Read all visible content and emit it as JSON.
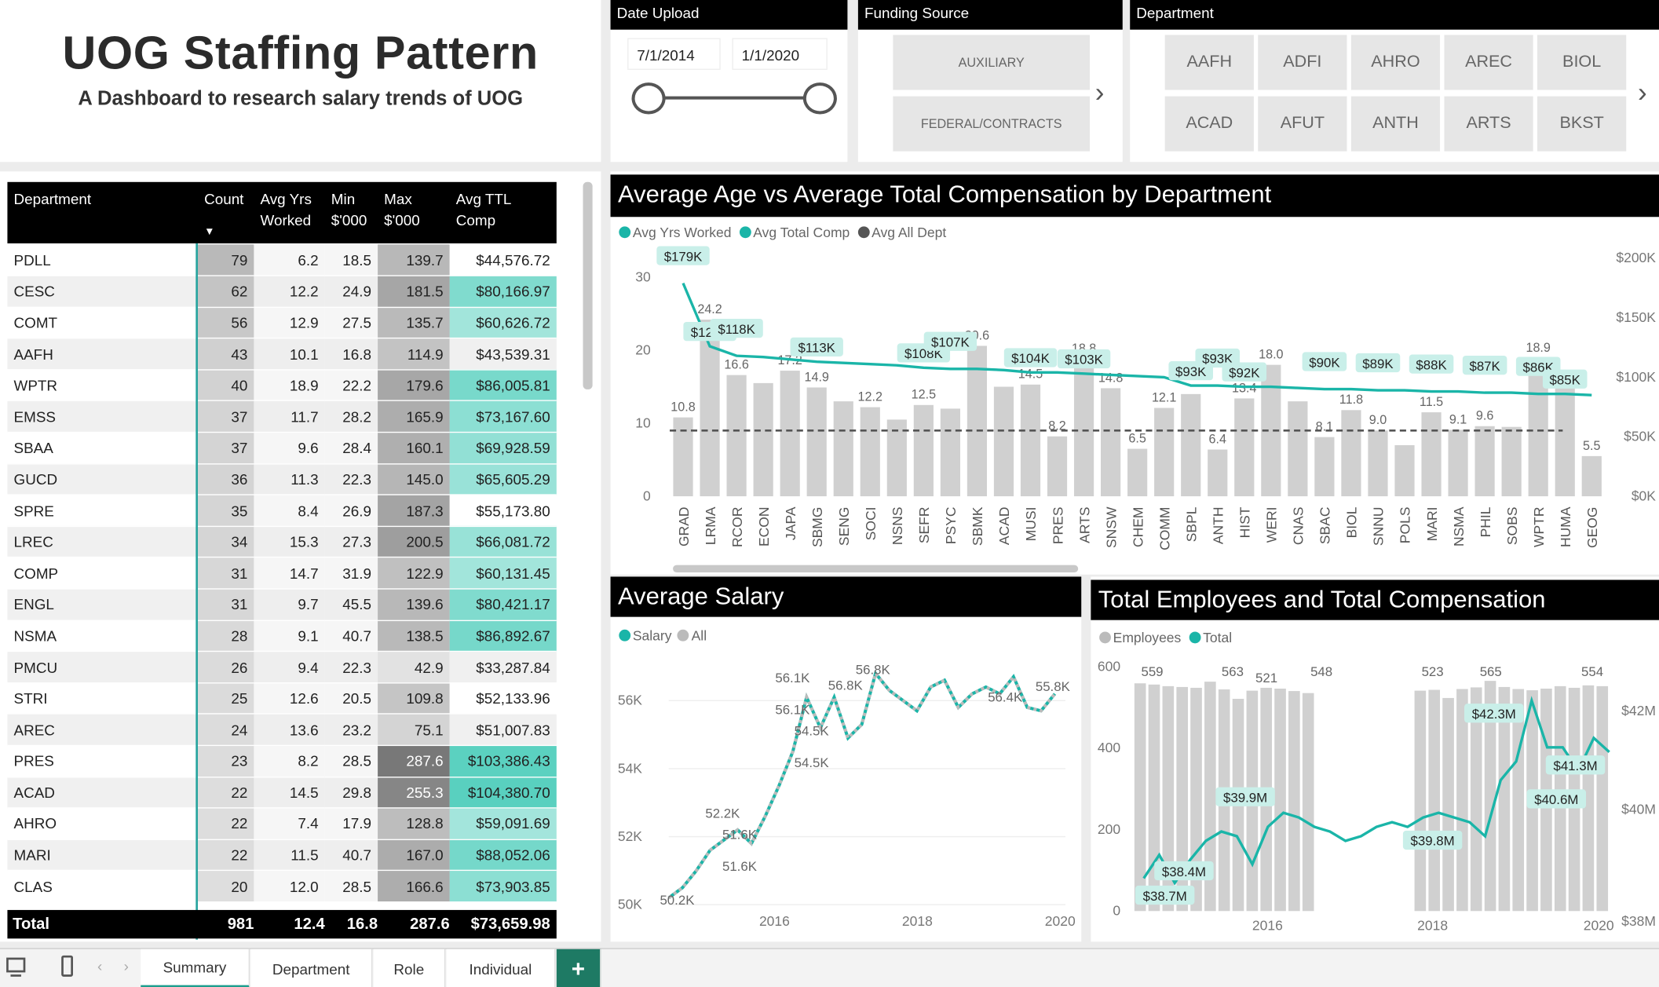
{
  "title": "UOG Staffing Pattern",
  "subtitle": "A Dashboard to research salary trends of UOG",
  "date_slicer": {
    "header": "Date Upload",
    "start": "7/1/2014",
    "end": "1/1/2020"
  },
  "funding_slicer": {
    "header": "Funding Source",
    "items": [
      "AUXILIARY",
      "FEDERAL/CONTRACTS"
    ]
  },
  "dept_slicer": {
    "header": "Department",
    "items": [
      "AAFH",
      "ADFI",
      "AHRO",
      "AREC",
      "BIOL",
      "ACAD",
      "AFUT",
      "ANTH",
      "ARTS",
      "BKST"
    ]
  },
  "table": {
    "headers": [
      {
        "l1": "Department",
        "l2": ""
      },
      {
        "l1": "Count",
        "l2": ""
      },
      {
        "l1": "Avg Yrs",
        "l2": "Worked"
      },
      {
        "l1": "Min",
        "l2": "$'000"
      },
      {
        "l1": "Max",
        "l2": "$'000"
      },
      {
        "l1": "Avg TTL",
        "l2": "Comp"
      }
    ],
    "rows": [
      [
        "PDLL",
        "79",
        "6.2",
        "18.5",
        "139.7",
        "$44,576.72"
      ],
      [
        "CESC",
        "62",
        "12.2",
        "24.9",
        "181.5",
        "$80,166.97"
      ],
      [
        "COMT",
        "56",
        "12.9",
        "27.5",
        "135.7",
        "$60,626.72"
      ],
      [
        "AAFH",
        "43",
        "10.1",
        "16.8",
        "114.9",
        "$43,539.31"
      ],
      [
        "WPTR",
        "40",
        "18.9",
        "22.2",
        "179.6",
        "$86,005.81"
      ],
      [
        "EMSS",
        "37",
        "11.7",
        "28.2",
        "165.9",
        "$73,167.60"
      ],
      [
        "SBAA",
        "37",
        "9.6",
        "28.4",
        "160.1",
        "$69,928.59"
      ],
      [
        "GUCD",
        "36",
        "11.3",
        "22.3",
        "145.0",
        "$65,605.29"
      ],
      [
        "SPRE",
        "35",
        "8.4",
        "26.9",
        "187.3",
        "$55,173.80"
      ],
      [
        "LREC",
        "34",
        "15.3",
        "27.3",
        "200.5",
        "$66,081.72"
      ],
      [
        "COMP",
        "31",
        "14.7",
        "31.9",
        "122.9",
        "$60,131.45"
      ],
      [
        "ENGL",
        "31",
        "9.7",
        "45.5",
        "139.6",
        "$80,421.17"
      ],
      [
        "NSMA",
        "28",
        "9.1",
        "40.7",
        "138.5",
        "$86,892.67"
      ],
      [
        "PMCU",
        "26",
        "9.4",
        "22.3",
        "42.9",
        "$33,287.84"
      ],
      [
        "STRI",
        "25",
        "12.6",
        "20.5",
        "109.8",
        "$52,133.96"
      ],
      [
        "AREC",
        "24",
        "13.6",
        "23.2",
        "75.1",
        "$51,007.83"
      ],
      [
        "PRES",
        "23",
        "8.2",
        "28.5",
        "287.6",
        "$103,386.43"
      ],
      [
        "ACAD",
        "22",
        "14.5",
        "29.8",
        "255.3",
        "$104,380.70"
      ],
      [
        "AHRO",
        "22",
        "7.4",
        "17.9",
        "128.8",
        "$59,091.69"
      ],
      [
        "MARI",
        "22",
        "11.5",
        "40.7",
        "167.0",
        "$88,052.06"
      ],
      [
        "CLAS",
        "20",
        "12.0",
        "28.5",
        "166.6",
        "$73,903.85"
      ]
    ],
    "total": [
      "Total",
      "981",
      "12.4",
      "16.8",
      "287.6",
      "$73,659.98"
    ]
  },
  "chart_data": [
    {
      "type": "bar",
      "title": "Average Age vs Average Total Compensation by Department",
      "legend": [
        "Avg Yrs Worked",
        "Avg Total Comp",
        "Avg All Dept"
      ],
      "categories": [
        "GRAD",
        "LRMA",
        "RCOR",
        "ECON",
        "JAPA",
        "SBMG",
        "SENG",
        "SOCI",
        "NSNS",
        "SEFR",
        "PSYC",
        "SBMK",
        "ACAD",
        "MUSI",
        "PRES",
        "ARTS",
        "SNSW",
        "CHEM",
        "COMM",
        "SBPL",
        "ANTH",
        "HIST",
        "WERI",
        "CNAS",
        "SBAC",
        "BIOL",
        "SNNU",
        "POLS",
        "MARI",
        "NSMA",
        "PHIL",
        "SOBS",
        "WPTR",
        "HUMA",
        "GEOG"
      ],
      "series": [
        {
          "name": "Avg Yrs Worked",
          "type": "bar",
          "values": [
            10.8,
            24.2,
            16.6,
            15.5,
            17.2,
            14.9,
            13.0,
            12.2,
            10.5,
            12.5,
            12.0,
            20.6,
            15.0,
            15.3,
            8.2,
            18.8,
            14.8,
            6.5,
            12.1,
            14.0,
            6.4,
            13.4,
            18.0,
            13.0,
            8.1,
            11.8,
            9.0,
            7.0,
            11.5,
            9.1,
            9.6,
            9.5,
            18.9,
            14.8,
            5.5
          ],
          "data_labels": [
            "10.8",
            "24.2",
            "16.6",
            "",
            "17.2",
            "14.9",
            "",
            "12.2",
            "",
            "12.5",
            "",
            "20.6",
            "",
            "14.5",
            "8.2",
            "18.8",
            "14.8",
            "6.5",
            "12.1",
            "",
            "6.4",
            "13.4",
            "18.0",
            "",
            "8.1",
            "11.8",
            "9.0",
            "",
            "11.5",
            "9.1",
            "9.6",
            "",
            "18.9",
            "14.8",
            "5.5"
          ]
        },
        {
          "name": "Avg Total Comp",
          "type": "line",
          "values": [
            179,
            126,
            118,
            117,
            115,
            113,
            112,
            111,
            110,
            108,
            107,
            107,
            106,
            104,
            104,
            103,
            102,
            101,
            100,
            93,
            93,
            92,
            92,
            91,
            90,
            90,
            89,
            89,
            88,
            88,
            87,
            87,
            86,
            86,
            85
          ],
          "data_labels": [
            "$179K",
            "$126K",
            "$118K",
            "",
            "",
            "$113K",
            "",
            "",
            "",
            "$108K",
            "$107K",
            "",
            "",
            "$104K",
            "",
            "$103K",
            "",
            "",
            "",
            "$93K",
            "$93K",
            "$92K",
            "",
            "",
            "$90K",
            "",
            "$89K",
            "",
            "$88K",
            "",
            "$87K",
            "",
            "$86K",
            "$85K",
            ""
          ]
        },
        {
          "name": "Avg All Dept",
          "type": "reference",
          "value": 9
        }
      ],
      "y_left": {
        "ticks": [
          "0",
          "10",
          "20",
          "30"
        ],
        "min": 0,
        "max": 30
      },
      "y_right": {
        "ticks": [
          "$0K",
          "$50K",
          "$100K",
          "$150K",
          "$200K"
        ],
        "min": 0,
        "max": 200
      }
    },
    {
      "type": "line",
      "title": "Average Salary",
      "legend": [
        "Salary",
        "All"
      ],
      "x_ticks": [
        "2016",
        "2018",
        "2020"
      ],
      "y_ticks": [
        "50K",
        "52K",
        "54K",
        "56K"
      ],
      "ylim": [
        50,
        57
      ],
      "values": [
        50.2,
        50.5,
        51.0,
        51.6,
        51.9,
        52.2,
        51.8,
        52.6,
        53.5,
        54.5,
        56.1,
        55.2,
        56.1,
        54.9,
        55.3,
        56.8,
        56.3,
        56.0,
        55.7,
        56.4,
        56.6,
        55.8,
        56.2,
        56.4,
        56.2,
        56.7,
        55.8,
        55.7,
        56.2
      ],
      "annotations": [
        "50.2K",
        "51.6K",
        "51.6K",
        "52.2K",
        "54.5K",
        "54.5K",
        "56.1K",
        "56.1K",
        "56.8K",
        "56.8K",
        "56.4K",
        "55.8K"
      ]
    },
    {
      "type": "bar",
      "title": "Total Employees and Total Compensation",
      "legend": [
        "Employees",
        "Total"
      ],
      "x_ticks": [
        "2016",
        "2018",
        "2020"
      ],
      "y_left": {
        "ticks": [
          "0",
          "200",
          "400",
          "600"
        ],
        "max": 600
      },
      "y_right": {
        "ticks": [
          "$38M",
          "$40M",
          "$42M"
        ]
      },
      "series": [
        {
          "name": "Employees",
          "type": "bar",
          "values": [
            559,
            556,
            552,
            550,
            548,
            563,
            544,
            521,
            541,
            548,
            546,
            540,
            535,
            0,
            0,
            0,
            0,
            0,
            0,
            0,
            541,
            543,
            523,
            545,
            549,
            565,
            550,
            545,
            542,
            546,
            552,
            548,
            554,
            552
          ]
        },
        {
          "name": "Total",
          "type": "line",
          "values": [
            38.5,
            39.0,
            38.4,
            38.9,
            39.3,
            39.5,
            39.4,
            38.8,
            39.6,
            39.9,
            39.8,
            39.6,
            39.5,
            39.3,
            39.4,
            39.6,
            39.7,
            39.6,
            39.8,
            39.9,
            39.8,
            39.7,
            39.4,
            40.6,
            41.0,
            42.3,
            41.3,
            41.3,
            40.8,
            41.5,
            41.2
          ]
        }
      ],
      "labels": [
        "559",
        "563",
        "521",
        "548",
        "523",
        "565",
        "554",
        "$38.7M",
        "$38.4M",
        "$39.9M",
        "$39.8M",
        "$42.3M",
        "$41.3M",
        "$40.6M"
      ]
    }
  ],
  "tabs": {
    "items": [
      "Summary",
      "Department",
      "Role",
      "Individual"
    ],
    "add": "+"
  }
}
